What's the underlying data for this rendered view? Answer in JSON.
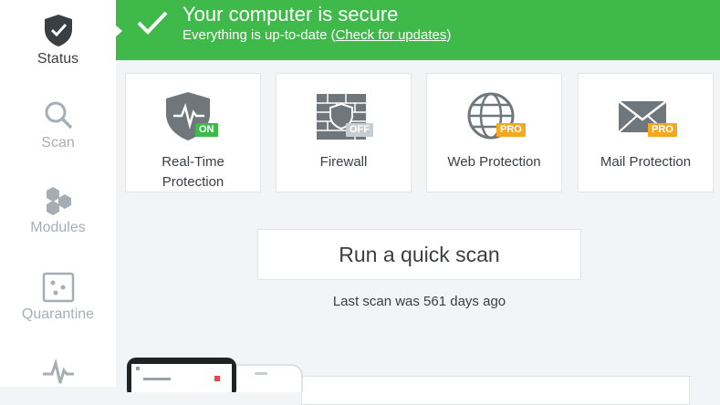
{
  "sidebar": {
    "items": [
      {
        "label": "Status",
        "icon": "shield-check-icon",
        "active": true
      },
      {
        "label": "Scan",
        "icon": "magnifier-icon",
        "active": false
      },
      {
        "label": "Modules",
        "icon": "hexagons-icon",
        "active": false
      },
      {
        "label": "Quarantine",
        "icon": "quarantine-box-icon",
        "active": false
      },
      {
        "label": "",
        "icon": "pulse-icon",
        "active": false
      }
    ]
  },
  "banner": {
    "title": "Your computer is secure",
    "subtitle_prefix": "Everything is up-to-date ",
    "link_open": "(",
    "link_label": "Check for updates",
    "link_close": ")",
    "color": "#3fb94a"
  },
  "modules": [
    {
      "label_line1": "Real-Time",
      "label_line2": "Protection",
      "badge": "ON",
      "badge_color": "#3fb94a",
      "icon": "shield-pulse-icon"
    },
    {
      "label_line1": "Firewall",
      "label_line2": "",
      "badge": "OFF",
      "badge_color": "#c8cdd0",
      "icon": "firewall-icon"
    },
    {
      "label_line1": "Web Protection",
      "label_line2": "",
      "badge": "PRO",
      "badge_color": "#f4a81d",
      "icon": "globe-icon"
    },
    {
      "label_line1": "Mail Protection",
      "label_line2": "",
      "badge": "PRO",
      "badge_color": "#f4a81d",
      "icon": "envelope-icon"
    }
  ],
  "quick_scan": {
    "label": "Run a quick scan"
  },
  "last_scan": {
    "text": "Last scan was 561 days ago"
  }
}
